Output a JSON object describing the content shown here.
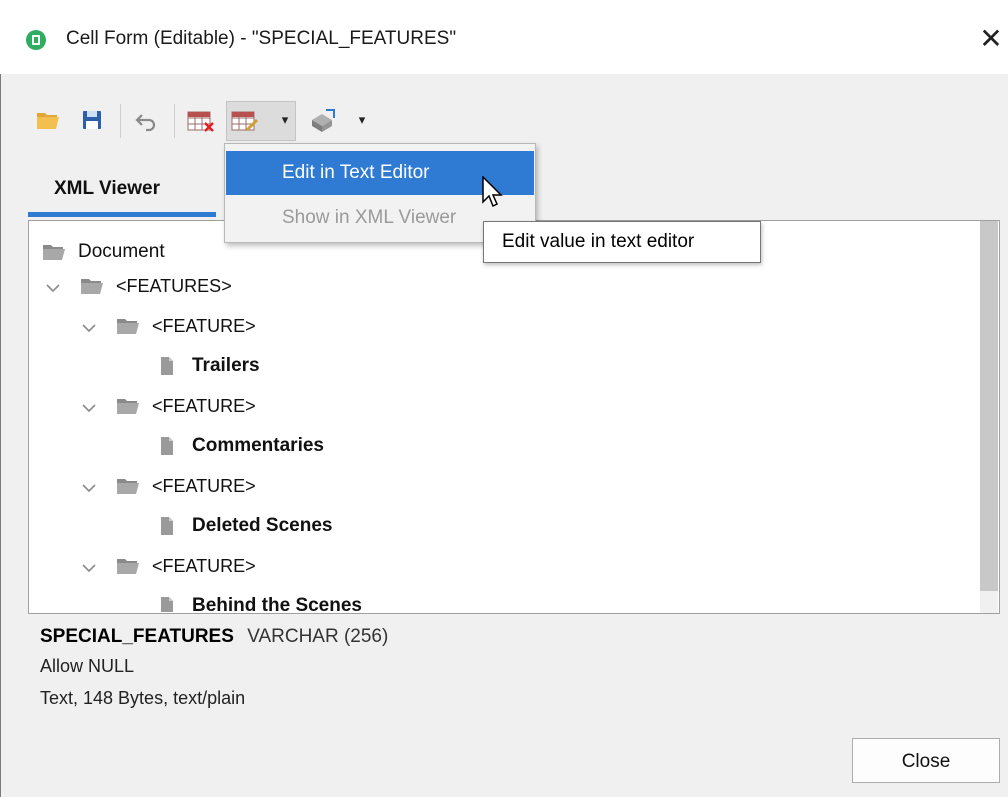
{
  "window": {
    "title": "Cell Form (Editable) - \"SPECIAL_FEATURES\"",
    "close_glyph": "✕"
  },
  "toolbar": {
    "buttons": [
      {
        "name": "open-folder-icon"
      },
      {
        "name": "save-icon"
      },
      {
        "name": "undo-icon"
      },
      {
        "name": "clear-value-icon"
      },
      {
        "name": "edit-value-icon"
      },
      {
        "name": "external-viewer-icon"
      }
    ],
    "dropdown_glyph": "▾"
  },
  "tabs": [
    {
      "label": "XML Viewer",
      "active": true
    }
  ],
  "dropdown_menu": {
    "items": [
      {
        "label": "Edit in Text Editor",
        "state": "highlighted"
      },
      {
        "label": "Show in XML Viewer",
        "state": "disabled"
      }
    ]
  },
  "tooltip": {
    "text": "Edit value in text editor"
  },
  "tree": {
    "nodes": [
      {
        "label": "Document",
        "type": "folder",
        "level": 0
      },
      {
        "label": "<FEATURES>",
        "type": "folder",
        "level": 1,
        "expanded": true
      },
      {
        "label": "<FEATURE>",
        "type": "folder",
        "level": 2,
        "expanded": true
      },
      {
        "label": "Trailers",
        "type": "text",
        "level": 3
      },
      {
        "label": "<FEATURE>",
        "type": "folder",
        "level": 2,
        "expanded": true
      },
      {
        "label": "Commentaries",
        "type": "text",
        "level": 3
      },
      {
        "label": "<FEATURE>",
        "type": "folder",
        "level": 2,
        "expanded": true
      },
      {
        "label": "Deleted Scenes",
        "type": "text",
        "level": 3
      },
      {
        "label": "<FEATURE>",
        "type": "folder",
        "level": 2,
        "expanded": true
      },
      {
        "label": "Behind the Scenes",
        "type": "text",
        "level": 3
      }
    ]
  },
  "column_info": {
    "name": "SPECIAL_FEATURES",
    "type": "VARCHAR (256)",
    "nullable": "Allow NULL",
    "content": "Text, 148 Bytes, text/plain"
  },
  "footer": {
    "close_label": "Close"
  },
  "colors": {
    "accent": "#2f7bd3",
    "app_icon": "#2fae61"
  }
}
